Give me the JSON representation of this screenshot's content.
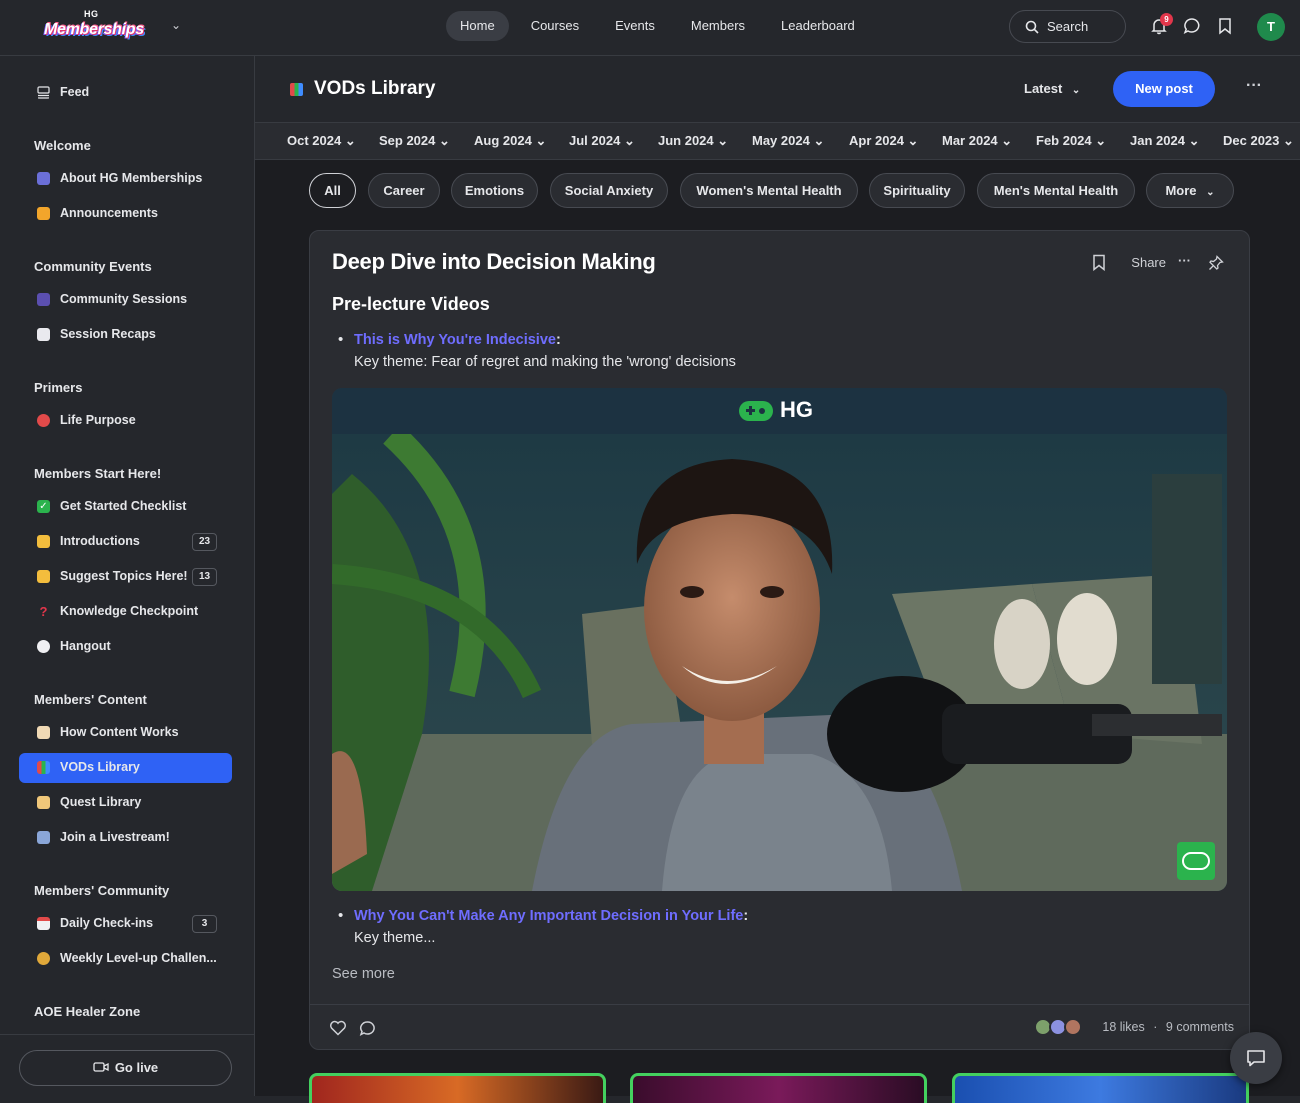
{
  "brand": {
    "logo_top": "HG",
    "logo_word": "Memberships"
  },
  "nav": {
    "items": [
      "Home",
      "Courses",
      "Events",
      "Members",
      "Leaderboard"
    ],
    "active": "Home"
  },
  "topbar": {
    "search_label": "Search",
    "notification_count": "9",
    "avatar_initial": "T"
  },
  "sidebar": {
    "feed": "Feed",
    "sections": [
      {
        "heading": "Welcome",
        "items": [
          {
            "label": "About HG Memberships",
            "icon": "rocket-icon"
          },
          {
            "label": "Announcements",
            "icon": "megaphone-icon"
          }
        ]
      },
      {
        "heading": "Community Events",
        "items": [
          {
            "label": "Community Sessions",
            "icon": "people-icon"
          },
          {
            "label": "Session Recaps",
            "icon": "memo-icon"
          }
        ]
      },
      {
        "heading": "Primers",
        "items": [
          {
            "label": "Life Purpose",
            "icon": "target-icon"
          }
        ]
      },
      {
        "heading": "Members Start Here!",
        "items": [
          {
            "label": "Get Started Checklist",
            "icon": "check-icon"
          },
          {
            "label": "Introductions",
            "icon": "wave-icon",
            "count": "23"
          },
          {
            "label": "Suggest Topics Here!",
            "icon": "pointing-hand-icon",
            "count": "13"
          },
          {
            "label": "Knowledge Checkpoint",
            "icon": "question-icon"
          },
          {
            "label": "Hangout",
            "icon": "speech-bubble-icon"
          }
        ]
      },
      {
        "heading": "Members' Content",
        "items": [
          {
            "label": "How Content Works",
            "icon": "document-icon"
          },
          {
            "label": "VODs Library",
            "icon": "books-icon",
            "active": true
          },
          {
            "label": "Quest Library",
            "icon": "scroll-icon"
          },
          {
            "label": "Join a Livestream!",
            "icon": "tv-icon"
          }
        ]
      },
      {
        "heading": "Members' Community",
        "items": [
          {
            "label": "Daily Check-ins",
            "icon": "calendar-icon",
            "count": "3"
          },
          {
            "label": "Weekly Level-up Challen...",
            "icon": "medal-icon"
          }
        ]
      },
      {
        "heading": "AOE Healer Zone",
        "items": []
      }
    ],
    "go_live": "Go live"
  },
  "page": {
    "title": "VODs Library",
    "sort": "Latest",
    "new_post": "New post",
    "months": [
      "Oct 2024",
      "Sep 2024",
      "Aug 2024",
      "Jul 2024",
      "Jun 2024",
      "May 2024",
      "Apr 2024",
      "Mar 2024",
      "Feb 2024",
      "Jan 2024",
      "Dec 2023"
    ],
    "chips": [
      "All",
      "Career",
      "Emotions",
      "Social Anxiety",
      "Women's Mental Health",
      "Spirituality",
      "Men's Mental Health",
      "More"
    ],
    "active_chip": "All"
  },
  "post": {
    "title": "Deep Dive into Decision Making",
    "share": "Share",
    "subtitle": "Pre-lecture Videos",
    "bullet1_link": "This is Why You're Indecisive",
    "bullet1_colon": ":",
    "bullet1_text": "Key theme: Fear of regret and making the 'wrong' decisions",
    "video_brand": "HG",
    "bullet2_link": "Why You Can't Make Any Important Decision in Your Life",
    "bullet2_colon": ":",
    "bullet2_text": "Key theme...",
    "see_more": "See more",
    "likes": "18 likes",
    "sep": "·",
    "comments": "9 comments"
  },
  "colors": {
    "accent": "#2f62f5",
    "link": "#6f6dff",
    "badge": "#e2364b",
    "thumb_border": "#44d05f"
  }
}
